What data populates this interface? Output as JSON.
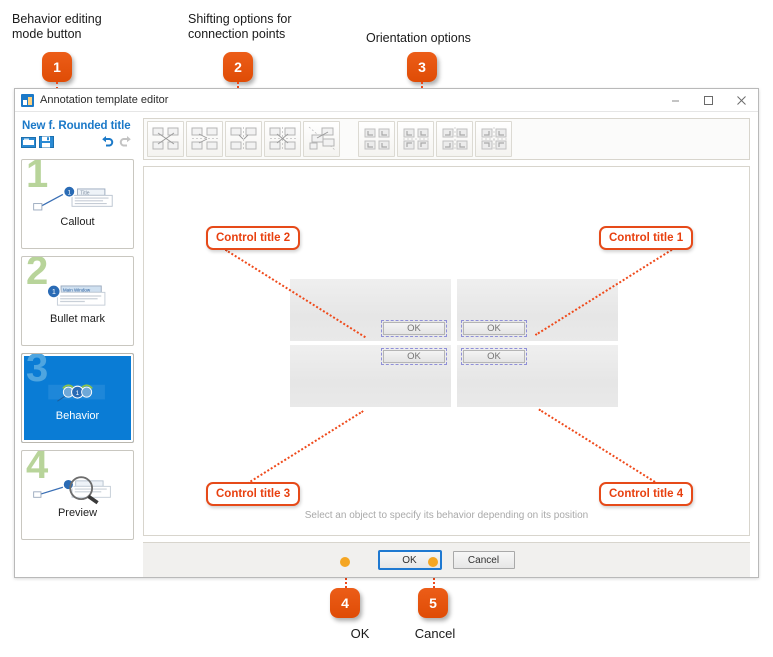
{
  "annotations": {
    "labels": [
      {
        "text": "Behavior editing\nmode button",
        "badge": "1"
      },
      {
        "text": "Shifting options for\nconnection points",
        "badge": "2"
      },
      {
        "text": "Orientation options",
        "badge": "3"
      }
    ],
    "bottom": [
      {
        "badge": "4",
        "text": "OK"
      },
      {
        "badge": "5",
        "text": "Cancel"
      }
    ],
    "accent_color": "#e8520f",
    "leader_color": "#ef4a1b"
  },
  "window": {
    "title": "Annotation template editor",
    "icon": "app-icon",
    "controls": {
      "minimize": "minimize-icon",
      "maximize": "maximize-icon",
      "close": "close-icon"
    }
  },
  "sidebar": {
    "title": "New f. Rounded title",
    "tools": {
      "open": "open-template-icon",
      "save": "save-template-icon",
      "undo": "undo-icon",
      "redo": "redo-icon"
    },
    "items": [
      {
        "number": "1",
        "label": "Callout",
        "selected": false
      },
      {
        "number": "2",
        "label": "Bullet mark",
        "selected": false
      },
      {
        "number": "3",
        "label": "Behavior",
        "selected": true
      },
      {
        "number": "4",
        "label": "Preview",
        "selected": false
      }
    ]
  },
  "toolbar": {
    "shift_group": [
      {
        "name": "shift-free-icon"
      },
      {
        "name": "shift-horizontal-icon"
      },
      {
        "name": "shift-vertical-icon"
      },
      {
        "name": "shift-both-icon"
      },
      {
        "name": "shift-diagonal-icon"
      }
    ],
    "orientation_group": [
      {
        "name": "orientation-none-icon"
      },
      {
        "name": "orientation-vertical-icon"
      },
      {
        "name": "orientation-horizontal-icon"
      },
      {
        "name": "orientation-both-icon"
      }
    ]
  },
  "canvas": {
    "hint": "Select an object to specify its behavior depending on its position",
    "quadrants": [
      {
        "id": "top-left",
        "button_label": "OK"
      },
      {
        "id": "top-right",
        "button_label": "OK"
      },
      {
        "id": "bottom-left",
        "button_label": "OK"
      },
      {
        "id": "bottom-right",
        "button_label": "OK"
      }
    ],
    "control_titles": [
      {
        "label": "Control title 1"
      },
      {
        "label": "Control title 2"
      },
      {
        "label": "Control title 3"
      },
      {
        "label": "Control title 4"
      }
    ]
  },
  "footer": {
    "ok_label": "OK",
    "cancel_label": "Cancel"
  }
}
